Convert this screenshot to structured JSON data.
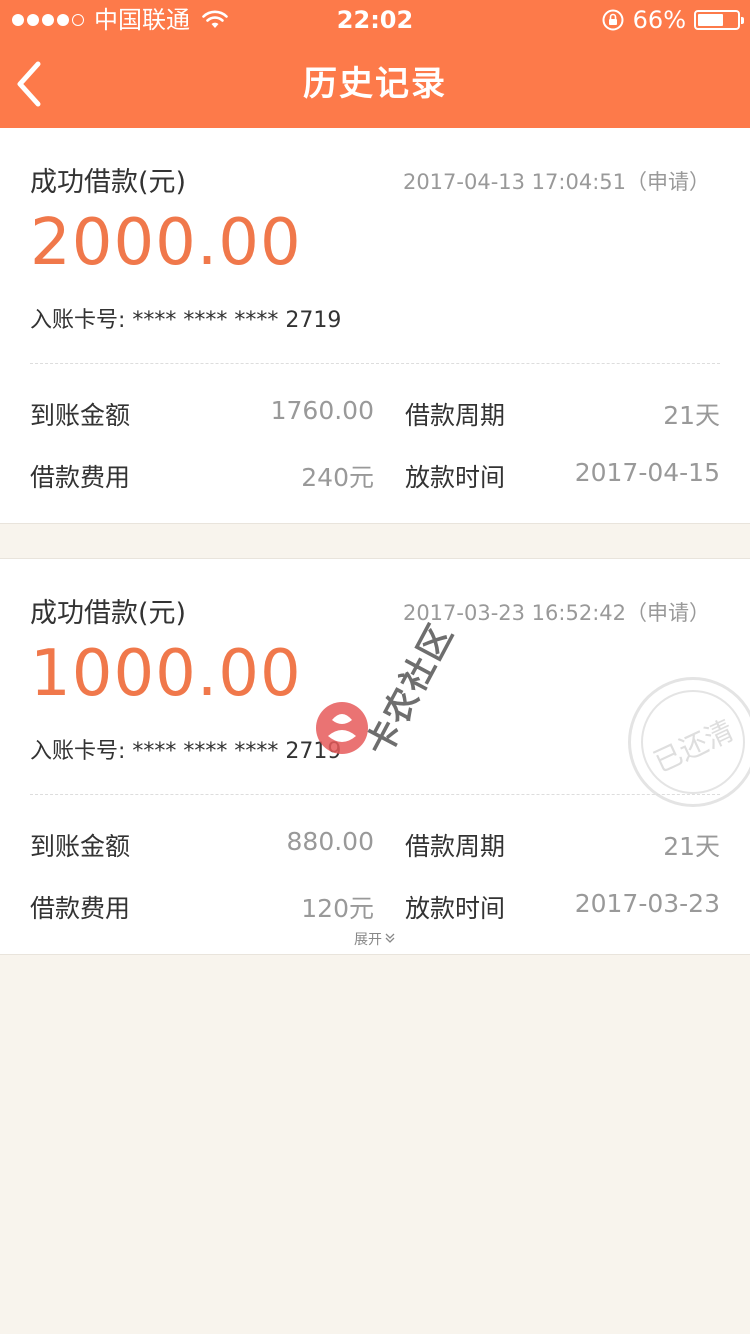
{
  "status_bar": {
    "carrier": "中国联通",
    "time": "22:02",
    "battery": "66%",
    "battery_level": 0.66,
    "signal_bars": 4
  },
  "nav": {
    "title": "历史记录",
    "back_icon": "chevron-left-icon"
  },
  "labels": {
    "received_amount": "到账金额",
    "loan_period": "借款周期",
    "loan_fee": "借款费用",
    "disburse_time": "放款时间",
    "card_no_prefix": "入账卡号:"
  },
  "loans": [
    {
      "title": "成功借款(元)",
      "apply_time": "2017-04-13 17:04:51（申请）",
      "amount": "2000.00",
      "card_no": "**** **** **** 2719",
      "received_amount": "1760.00",
      "loan_period": "21天",
      "loan_fee": "240元",
      "disburse_time": "2017-04-15"
    },
    {
      "title": "成功借款(元)",
      "apply_time": "2017-03-23 16:52:42（申请）",
      "amount": "1000.00",
      "card_no": "**** **** **** 2719",
      "received_amount": "880.00",
      "loan_period": "21天",
      "loan_fee": "120元",
      "disburse_time": "2017-03-23",
      "stamp": "已还清",
      "expand_label": "展开"
    }
  ],
  "watermark": {
    "text": "卡农社区"
  },
  "colors": {
    "accent": "#fd7a4a",
    "amount": "#f0784b",
    "background": "#f8f4ed"
  }
}
